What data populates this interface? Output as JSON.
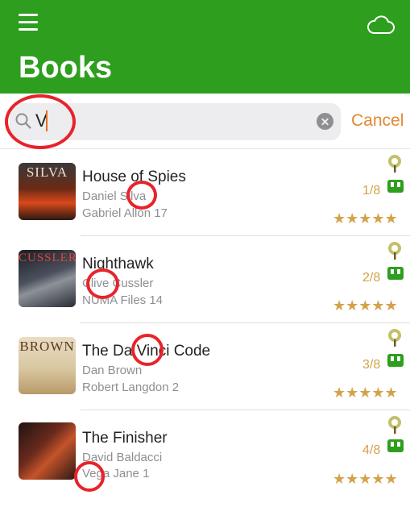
{
  "header": {
    "title": "Books",
    "accent_color": "#2e9e1e",
    "menu_icon": "hamburger-menu-icon",
    "sync_icon": "cloud-icon"
  },
  "search": {
    "value": "V",
    "placeholder": "",
    "cancel_label": "Cancel"
  },
  "books": [
    {
      "title": "House of Spies",
      "author": "Daniel Silva",
      "series": "Gabriel Allon 17",
      "position": "1/8",
      "rating": "★★★★★",
      "cover_text": "SILVA"
    },
    {
      "title": "Nighthawk",
      "author": "Clive Cussler",
      "series": "NUMA Files 14",
      "position": "2/8",
      "rating": "★★★★★",
      "cover_text": "CUSSLER"
    },
    {
      "title": "The Da Vinci Code",
      "author": "Dan Brown",
      "series": "Robert Langdon 2",
      "position": "3/8",
      "rating": "★★★★★",
      "cover_text": "BROWN"
    },
    {
      "title": "The Finisher",
      "author": "David Baldacci",
      "series": "Vega Jane 1",
      "position": "4/8",
      "rating": "★★★★★",
      "cover_text": ""
    }
  ]
}
